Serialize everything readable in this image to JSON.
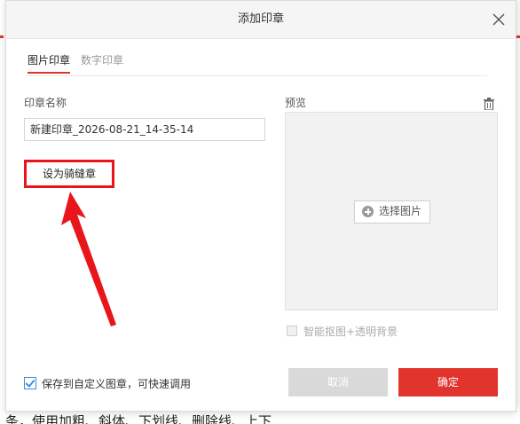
{
  "dialog": {
    "title": "添加印章",
    "tabs": [
      {
        "label": "图片印章",
        "active": true
      },
      {
        "label": "数字印章",
        "active": false
      }
    ],
    "name_label": "印章名称",
    "name_value": "新建印章_2026-08-21_14-35-14",
    "seam_button_label": "设为骑缝章",
    "preview_label": "预览",
    "choose_image_label": "选择图片",
    "smart_cutout_label": "智能抠图+透明背景",
    "smart_cutout_checked": false,
    "save_custom_label": "保存到自定义图章，可快速调用",
    "save_custom_checked": true,
    "cancel_label": "取消",
    "ok_label": "确定"
  },
  "background": {
    "bottom_text": "条，使用加粗、斜体、下划线、删除线、上下"
  },
  "colors": {
    "accent": "#e0342c",
    "highlight_box": "#e8151b",
    "checkbox_blue": "#3e8ede"
  },
  "icons": {
    "close": "close-icon",
    "trash": "trash-icon",
    "plus": "plus-circle-icon",
    "annotation": "red-arrow-annotation"
  }
}
